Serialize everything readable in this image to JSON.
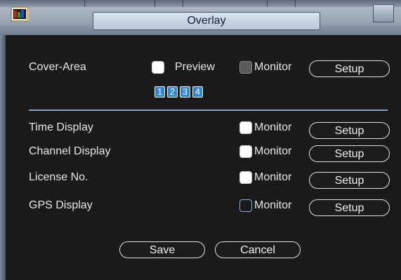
{
  "window": {
    "title": "Overlay",
    "icon": "monitor-icon",
    "close_icon": "close-icon"
  },
  "cover_area": {
    "label": "Cover-Area",
    "preview_label": "Preview",
    "monitor_label": "Monitor",
    "setup_label": "Setup",
    "areas": [
      "1",
      "2",
      "3",
      "4"
    ]
  },
  "rows": [
    {
      "label": "Time Display",
      "monitor_label": "Monitor",
      "setup_label": "Setup"
    },
    {
      "label": "Channel Display",
      "monitor_label": "Monitor",
      "setup_label": "Setup"
    },
    {
      "label": "License No.",
      "monitor_label": "Monitor",
      "setup_label": "Setup"
    },
    {
      "label": "GPS Display",
      "monitor_label": "Monitor",
      "setup_label": "Setup"
    }
  ],
  "footer": {
    "save_label": "Save",
    "cancel_label": "Cancel"
  },
  "colors": {
    "accent": "#2e86d8",
    "background": "#1a1a1a",
    "titlebar": "#9aa6b4"
  }
}
